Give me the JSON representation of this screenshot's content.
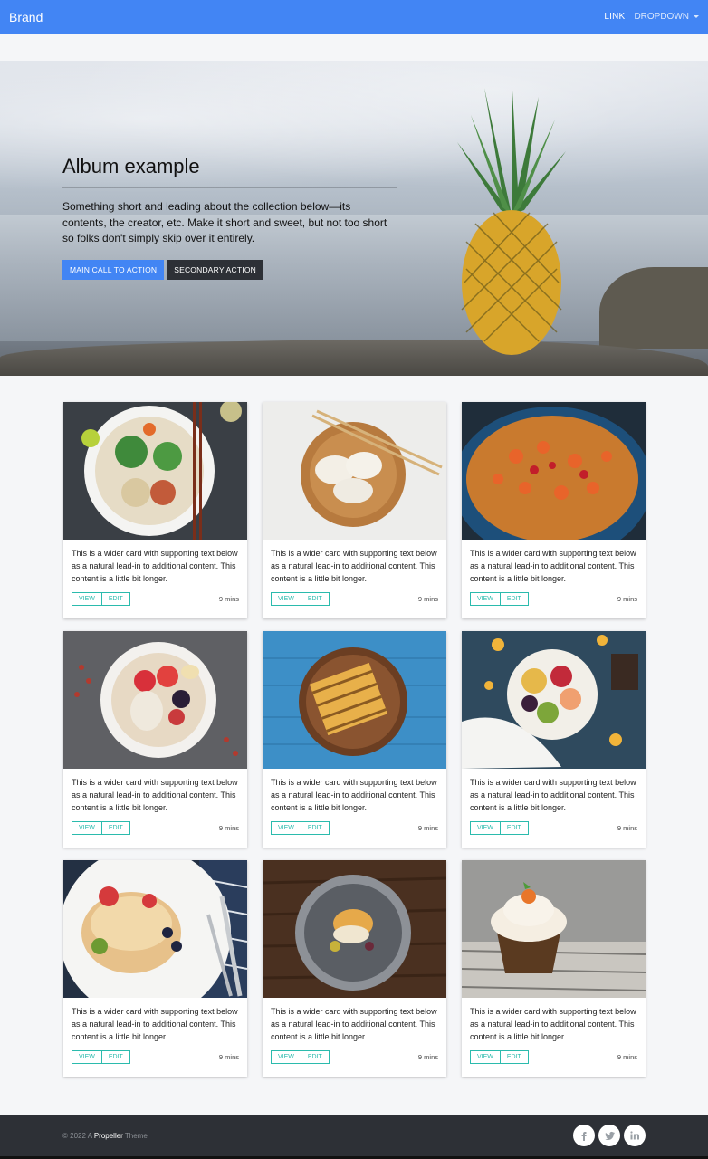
{
  "navbar": {
    "brand": "Brand",
    "link": "LINK",
    "dropdown": "DROPDOWN"
  },
  "hero": {
    "title": "Album example",
    "lead": "Something short and leading about the collection below—its contents, the creator, etc. Make it short and sweet, but not too short so folks don't simply skip over it entirely.",
    "primary_button": "MAIN CALL TO ACTION",
    "secondary_button": "SECONDARY ACTION"
  },
  "cards": [
    {
      "image": "salad bowl with chopsticks",
      "text": "This is a wider card with supporting text below as a natural lead-in to additional content. This content is a little bit longer.",
      "view": "VIEW",
      "edit": "EDIT",
      "time": "9 mins"
    },
    {
      "image": "dumplings on wooden plate",
      "text": "This is a wider card with supporting text below as a natural lead-in to additional content. This content is a little bit longer.",
      "view": "VIEW",
      "edit": "EDIT",
      "time": "9 mins"
    },
    {
      "image": "paella with shrimp",
      "text": "This is a wider card with supporting text below as a natural lead-in to additional content. This content is a little bit longer.",
      "view": "VIEW",
      "edit": "EDIT",
      "time": "9 mins"
    },
    {
      "image": "acai bowl with berries",
      "text": "This is a wider card with supporting text below as a natural lead-in to additional content. This content is a little bit longer.",
      "view": "VIEW",
      "edit": "EDIT",
      "time": "9 mins"
    },
    {
      "image": "grilled sandwich on blue table",
      "text": "This is a wider card with supporting text below as a natural lead-in to additional content. This content is a little bit longer.",
      "view": "VIEW",
      "edit": "EDIT",
      "time": "9 mins"
    },
    {
      "image": "fruit platter",
      "text": "This is a wider card with supporting text below as a natural lead-in to additional content. This content is a little bit longer.",
      "view": "VIEW",
      "edit": "EDIT",
      "time": "9 mins"
    },
    {
      "image": "pancakes with fruit",
      "text": "This is a wider card with supporting text below as a natural lead-in to additional content. This content is a little bit longer.",
      "view": "VIEW",
      "edit": "EDIT",
      "time": "9 mins"
    },
    {
      "image": "fish dish on dark plate",
      "text": "This is a wider card with supporting text below as a natural lead-in to additional content. This content is a little bit longer.",
      "view": "VIEW",
      "edit": "EDIT",
      "time": "9 mins"
    },
    {
      "image": "cupcake on wooden table",
      "text": "This is a wider card with supporting text below as a natural lead-in to additional content. This content is a little bit longer.",
      "view": "VIEW",
      "edit": "EDIT",
      "time": "9 mins"
    }
  ],
  "footer": {
    "copyright_prefix": "© 2022 A",
    "brand_link": "Propeller",
    "copyright_suffix": "Theme",
    "social": [
      "facebook-icon",
      "twitter-icon",
      "linkedin-icon"
    ]
  },
  "colors": {
    "primary": "#4285f4",
    "secondary": "#2d3036",
    "accent": "#2bbbad",
    "footer_bg": "#2d3036"
  }
}
